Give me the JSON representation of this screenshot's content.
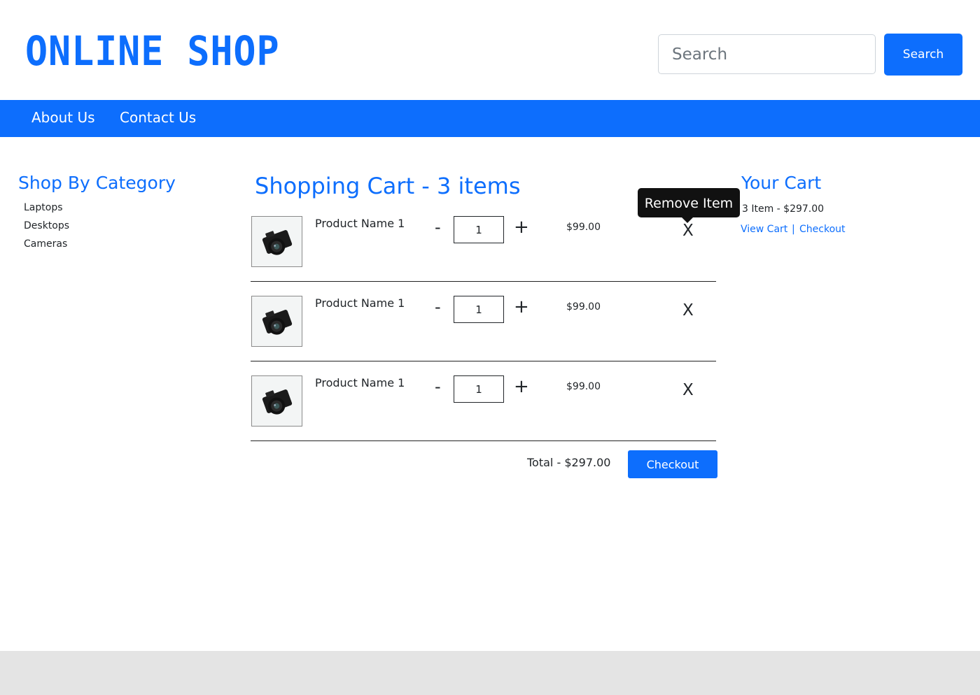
{
  "header": {
    "logo_text": "ONLINE SHOP",
    "search_placeholder": "Search",
    "search_button_label": "Search"
  },
  "nav": {
    "items": [
      {
        "label": "About Us"
      },
      {
        "label": "Contact Us"
      }
    ]
  },
  "sidebar": {
    "title": "Shop By Category",
    "categories": [
      {
        "label": "Laptops"
      },
      {
        "label": "Desktops"
      },
      {
        "label": "Cameras"
      }
    ]
  },
  "cart": {
    "title": "Shopping Cart - 3 items",
    "items": [
      {
        "name": "Product Name 1",
        "quantity": "1",
        "price": "$99.00",
        "remove_label": "X",
        "image": "camera-image"
      },
      {
        "name": "Product Name 1",
        "quantity": "1",
        "price": "$99.00",
        "remove_label": "X",
        "image": "camera-image"
      },
      {
        "name": "Product Name 1",
        "quantity": "1",
        "price": "$99.00",
        "remove_label": "X",
        "image": "camera-image"
      }
    ],
    "minus_label": "-",
    "plus_label": "+",
    "total": "Total - $297.00",
    "checkout_label": "Checkout"
  },
  "tooltip": {
    "text": "Remove Item"
  },
  "summary": {
    "title": "Your Cart",
    "count_total": "3 Item - $297.00",
    "view_cart_label": "View Cart",
    "separator": "|",
    "checkout_label": "Checkout"
  },
  "colors": {
    "accent": "#0d6efd",
    "footer": "#e4e4e4",
    "tooltip": "#111111"
  }
}
